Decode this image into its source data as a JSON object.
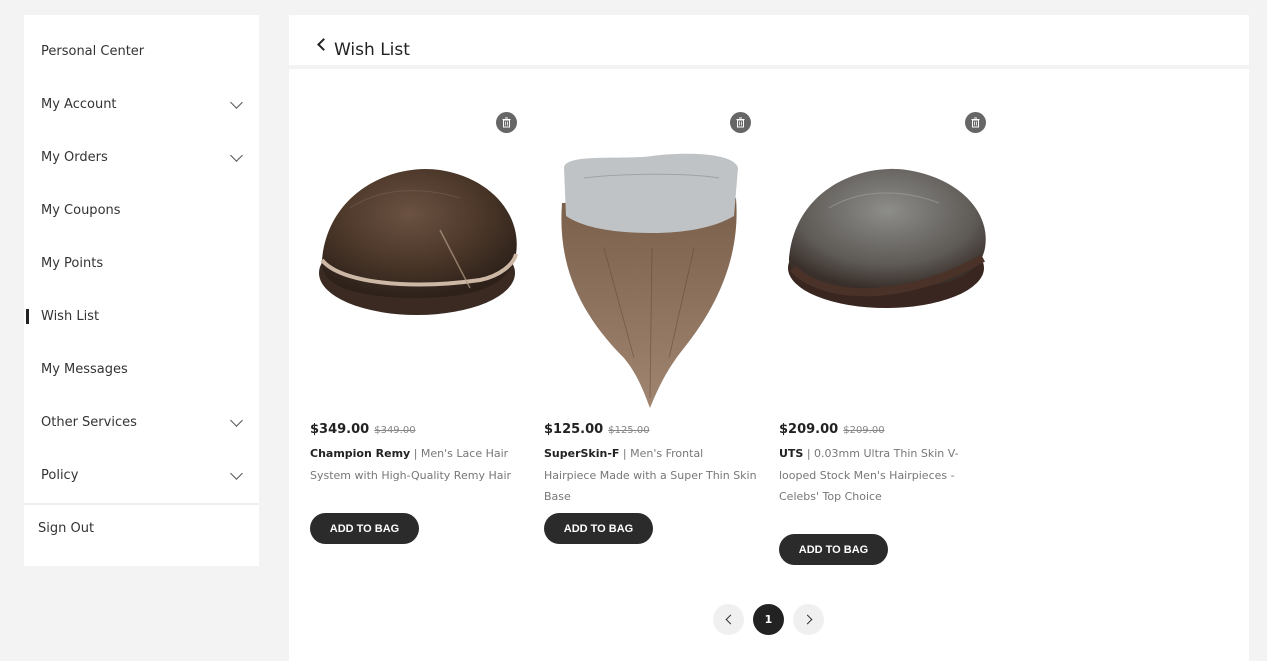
{
  "sidebar": {
    "items": [
      {
        "label": "Personal Center"
      },
      {
        "label": "My Account"
      },
      {
        "label": "My Orders"
      },
      {
        "label": "My Coupons"
      },
      {
        "label": "My Points"
      },
      {
        "label": "Wish List"
      },
      {
        "label": "My Messages"
      },
      {
        "label": "Other Services"
      },
      {
        "label": "Policy"
      }
    ],
    "sign_out": "Sign Out"
  },
  "header": {
    "title": "Wish List"
  },
  "products": [
    {
      "price": "$349.00",
      "old_price": "$349.00",
      "name": "Champion Remy",
      "description": " | Men's Lace Hair System with High-Quality Remy Hair",
      "button": "ADD TO BAG"
    },
    {
      "price": "$125.00",
      "old_price": "$125.00",
      "name": "SuperSkin-F",
      "description": " | Men's Frontal Hairpiece Made with a Super Thin Skin Base",
      "button": "ADD TO BAG"
    },
    {
      "price": "$209.00",
      "old_price": "$209.00",
      "name": "UTS",
      "description": " | 0.03mm Ultra Thin Skin V-looped Stock Men's Hairpieces - Celebs' Top Choice",
      "button": "ADD TO BAG"
    }
  ],
  "pagination": {
    "current": "1"
  },
  "colors": {
    "accent": "#2b2b2b",
    "background": "#f3f3f3"
  }
}
